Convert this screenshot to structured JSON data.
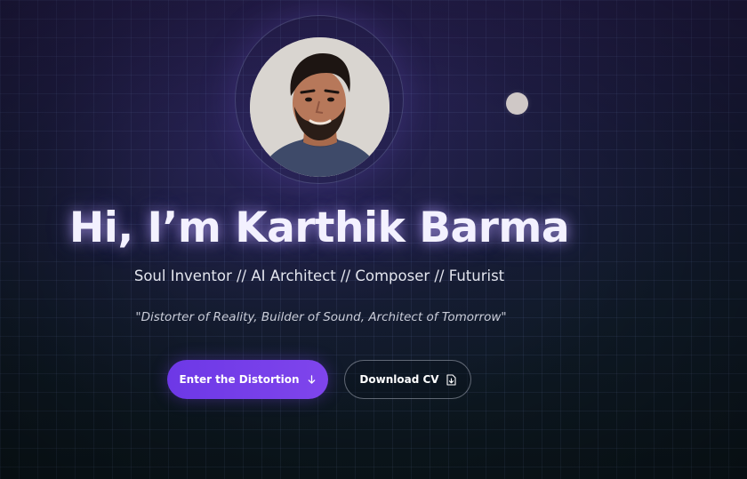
{
  "hero": {
    "name_heading": "Hi, I’m Karthik Barma",
    "roles": "Soul Inventor // AI Architect // Composer // Futurist",
    "tagline": "\"Distorter of Reality, Builder of Sound, Architect of Tomorrow\""
  },
  "buttons": {
    "primary_label": "Enter the Distortion",
    "primary_icon": "arrow-down-icon",
    "secondary_label": "Download CV",
    "secondary_icon": "file-download-icon"
  },
  "colors": {
    "accent": "#7a40ea",
    "background_top": "#211c46",
    "background_bottom": "#0b161c"
  }
}
